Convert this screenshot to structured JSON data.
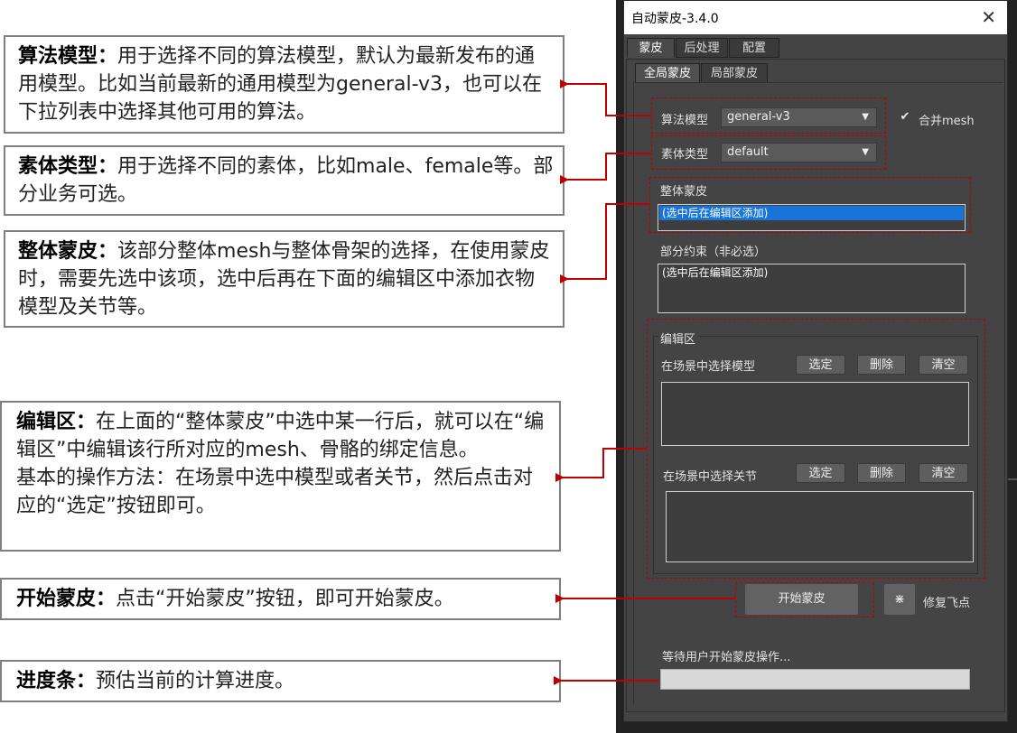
{
  "dialog": {
    "title": "自动蒙皮-3.4.0",
    "close_glyph": "✕",
    "tabs": [
      "蒙皮",
      "后处理",
      "配置"
    ],
    "subtabs": [
      "全局蒙皮",
      "局部蒙皮"
    ]
  },
  "fields": {
    "algorithm_label": "算法模型",
    "algorithm_value": "general-v3",
    "merge_mesh_label": "合并mesh",
    "merge_mesh_checked": true,
    "body_type_label": "素体类型",
    "body_type_value": "default"
  },
  "whole_skin": {
    "label": "整体蒙皮",
    "row": "(选中后在编辑区添加)"
  },
  "partial_constraint": {
    "label": "部分约束（非必选）",
    "row": "(选中后在编辑区添加)"
  },
  "edit_area": {
    "title": "编辑区",
    "model_label": "在场景中选择模型",
    "joint_label": "在场景中选择关节",
    "select": "选定",
    "delete": "删除",
    "clear": "清空"
  },
  "actions": {
    "start_skin": "开始蒙皮",
    "fix_glyph": "⋇",
    "fix_label": "修复飞点"
  },
  "status": {
    "text": "等待用户开始蒙皮操作...",
    "progress": 0
  },
  "annotations": [
    {
      "title": "算法模型：",
      "body": "用于选择不同的算法模型，默认为最新发布的通用模型。比如当前最新的通用模型为general-v3，也可以在下拉列表中选择其他可用的算法。"
    },
    {
      "title": "素体类型：",
      "body": "用于选择不同的素体，比如male、female等。部分业务可选。"
    },
    {
      "title": "整体蒙皮：",
      "body": "该部分整体mesh与整体骨架的选择，在使用蒙皮时，需要先选中该项，选中后再在下面的编辑区中添加衣物模型及关节等。"
    },
    {
      "title": "编辑区：",
      "body": "在上面的“整体蒙皮”中选中某一行后，就可以在“编辑区”中编辑该行所对应的mesh、骨骼的绑定信息。",
      "body2": "基本的操作方法：在场景中选中模型或者关节，然后点击对应的“选定”按钮即可。"
    },
    {
      "title": "开始蒙皮：",
      "body": "点击“开始蒙皮”按钮，即可开始蒙皮。"
    },
    {
      "title": "进度条：",
      "body": "预估当前的计算进度。"
    }
  ],
  "colors": {
    "highlight_dash": "#c00000",
    "arrow": "#c00000",
    "selection": "#1874d9",
    "panel": "#444444"
  }
}
